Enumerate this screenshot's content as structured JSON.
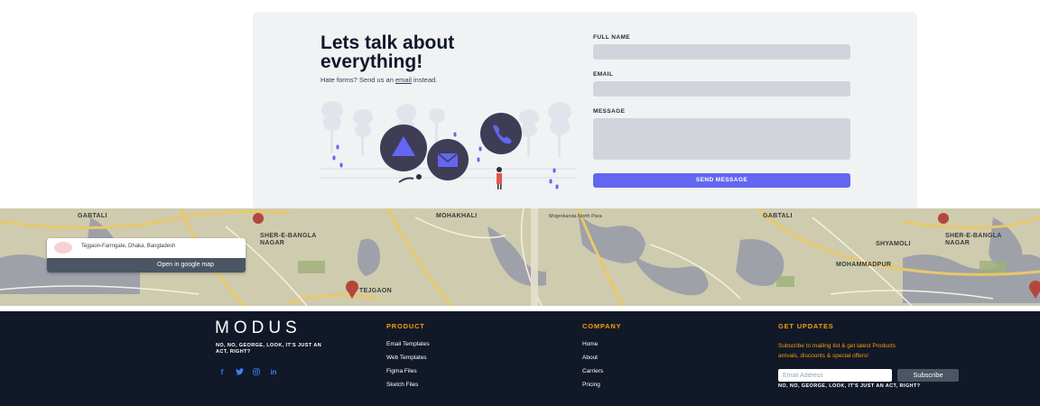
{
  "contact": {
    "headline": "Lets talk about everything!",
    "sub_before": "Hate forms? Send us an ",
    "sub_link": "email",
    "sub_after": " instead.",
    "full_name_label": "FULL NAME",
    "email_label": "EMAIL",
    "message_label": "MESSAGE",
    "send_label": "SEND MESSAGE",
    "accent": "#6366f1"
  },
  "map": {
    "labels": [
      "GABTALI",
      "SHER-E-BANGLA NAGAR",
      "MOHAKHALI",
      "Mogrokanda North Para",
      "TEJGAON",
      "SHYAMOLI",
      "MOHAMMADPUR",
      "GABTALI",
      "SHER-E-BANGLA NAGAR"
    ],
    "card_address": "Tejgaon-Farmgate, Dhaka, Bangladesh",
    "open_label": "Open in google map"
  },
  "footer": {
    "logo": "MODUS",
    "tagline": "NO, NO, GEORGE, LOOK, IT'S JUST AN ACT, RIGHT?",
    "socials": [
      "f",
      "t",
      "ig",
      "in"
    ],
    "product_title": "PRODUCT",
    "product_items": [
      "Email Templates",
      "Web Templates",
      "Figma Files",
      "Sketch Files"
    ],
    "company_title": "COMPANY",
    "company_items": [
      "Home",
      "About",
      "Carriers",
      "Pricing"
    ],
    "updates_title": "GET UPDATES",
    "updates_text": "Subscribe to mailing list & get latest Products arrivals, discounts & special offers!",
    "email_placeholder": "Email Address",
    "subscribe_label": "Subscribe",
    "tagline2": "NO, NO, GEORGE, LOOK, IT'S JUST AN ACT, RIGHT?",
    "accent": "#f59e0b",
    "background": "#111827"
  }
}
